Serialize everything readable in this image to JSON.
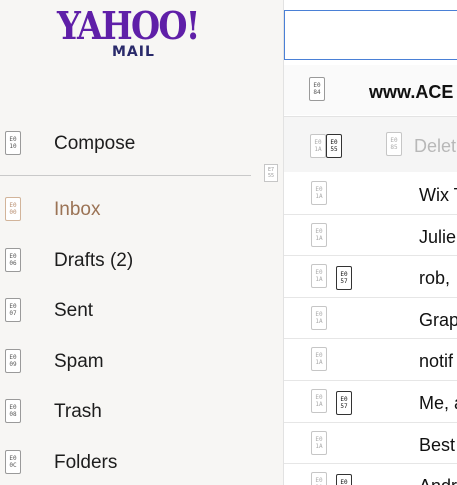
{
  "logo": {
    "word": "YAHOO!",
    "sub": "MAIL"
  },
  "sidebar": {
    "items": [
      {
        "label": "Compose",
        "glyph": "E0\n10"
      },
      {
        "label": "Inbox",
        "glyph": "E0\n00",
        "active": true
      },
      {
        "label": "Drafts (2)",
        "glyph": "E0\n06"
      },
      {
        "label": "Sent",
        "glyph": "E0\n07"
      },
      {
        "label": "Spam",
        "glyph": "E0\n09"
      },
      {
        "label": "Trash",
        "glyph": "E0\n08"
      },
      {
        "label": "Folders",
        "glyph": "E0\n0C"
      }
    ],
    "resize_glyph": "E7\n55"
  },
  "search": {
    "value": "",
    "placeholder": ""
  },
  "header": {
    "title": "www.ACE",
    "glyph": "E0\n84"
  },
  "toolbar": {
    "select_glyph": "E0\n1A",
    "select_menu_glyph": "E0\n55",
    "delete_glyph": "E0\n85",
    "delete_label": "Delet"
  },
  "messages": [
    {
      "sender": "Wix T",
      "check_glyph": "E0\n1A",
      "flag_glyph": ""
    },
    {
      "sender": "Julie",
      "check_glyph": "E0\n1A",
      "flag_glyph": ""
    },
    {
      "sender": "rob,",
      "check_glyph": "E0\n1A",
      "flag_glyph": "E0\n57"
    },
    {
      "sender": "Grap",
      "check_glyph": "E0\n1A",
      "flag_glyph": ""
    },
    {
      "sender": "notif",
      "check_glyph": "E0\n1A",
      "flag_glyph": ""
    },
    {
      "sender": "Me, a",
      "check_glyph": "E0\n1A",
      "flag_glyph": "E0\n57"
    },
    {
      "sender": "Best",
      "check_glyph": "E0\n1A",
      "flag_glyph": ""
    },
    {
      "sender": "Andr",
      "check_glyph": "E0\n1A",
      "flag_glyph": "E0\n57"
    }
  ]
}
